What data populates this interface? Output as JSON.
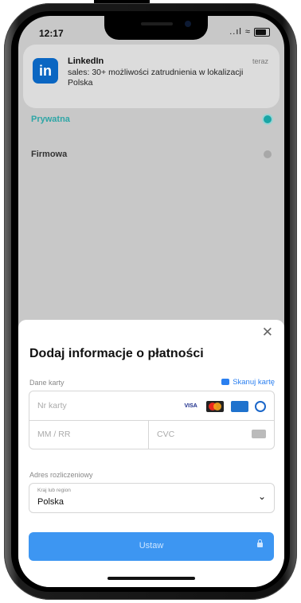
{
  "status_bar": {
    "time": "12:17",
    "signal_text": "..ıl ≈"
  },
  "notification": {
    "app_name": "LinkedIn",
    "time": "teraz",
    "message": "sales: 30+ możliwości zatrudnienia w lokalizacji Polska",
    "icon_text": "in"
  },
  "options": [
    {
      "label": "Prywatna",
      "selected": true
    },
    {
      "label": "Firmowa",
      "selected": false
    }
  ],
  "sheet": {
    "close_glyph": "✕",
    "title": "Dodaj informacje o płatności",
    "card_section_label": "Dane karty",
    "scan_label": "Skanuj kartę",
    "card_number_placeholder": "Nr karty",
    "expiry_placeholder": "MM / RR",
    "cvc_placeholder": "CVC",
    "brands": [
      "VISA",
      "Mastercard",
      "Amex",
      "Diners"
    ],
    "address_label": "Adres rozliczeniowy",
    "region_caption": "Kraj lub region",
    "region_value": "Polska",
    "submit_label": "Ustaw"
  },
  "colors": {
    "accent": "#3d96f2",
    "selected": "#1aa6a6",
    "linkedin": "#0a66c2"
  }
}
